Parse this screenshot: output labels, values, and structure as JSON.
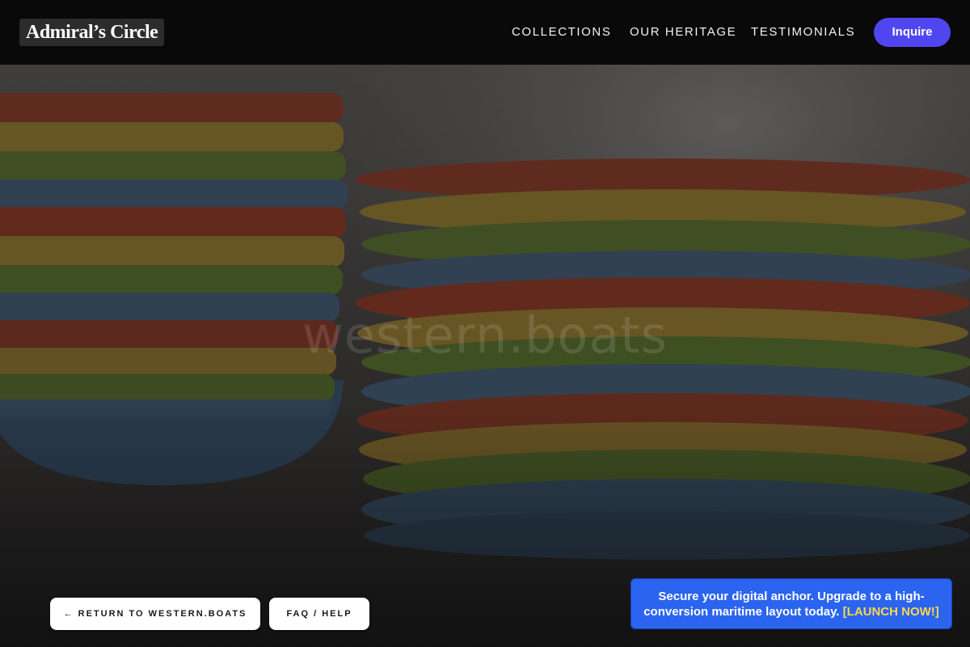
{
  "header": {
    "logo": "Admiral’s Circle",
    "nav": [
      "COLLECTIONS",
      "OUR HERITAGE",
      "TESTIMONIALS"
    ],
    "cta_label": "Inquire"
  },
  "hero": {
    "watermark": "western.boats",
    "image_subject": "stacked colorful ceramic plates and bowls",
    "plate_colors": [
      "#7a3426",
      "#7d6a2c",
      "#4c5e2a",
      "#3f5266"
    ]
  },
  "bottom_buttons": {
    "return_label": "← RETURN TO WESTERN.BOATS",
    "faq_label": "FAQ / HELP"
  },
  "promo": {
    "text": "Secure your digital anchor. Upgrade to a high-conversion maritime layout today.",
    "cta": "[LAUNCH NOW!]",
    "bg_color": "#2b64ef",
    "cta_color": "#ffd84a"
  },
  "colors": {
    "header_bg": "#080808",
    "accent": "#5046f0"
  }
}
